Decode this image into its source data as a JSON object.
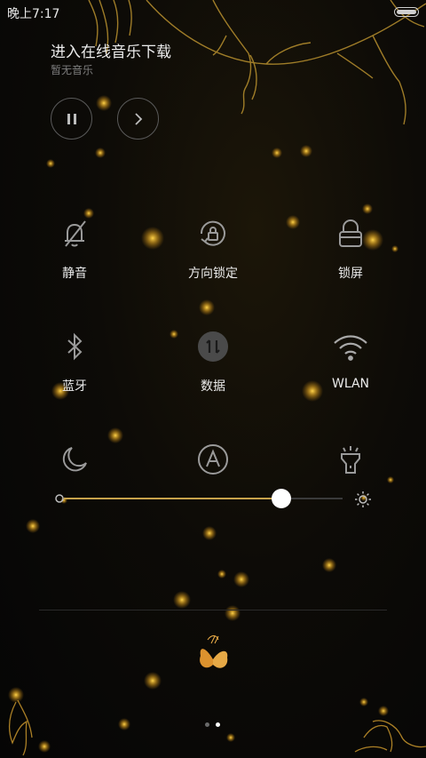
{
  "status_bar": {
    "time": "晚上7:17",
    "battery_icon": "battery-icon"
  },
  "music": {
    "title": "进入在线音乐下载",
    "subtitle": "暂无音乐",
    "pause_icon": "pause-icon",
    "next_icon": "next-icon"
  },
  "toggles": [
    {
      "label": "静音",
      "icon": "bell-off-icon"
    },
    {
      "label": "方向锁定",
      "icon": "rotation-lock-icon"
    },
    {
      "label": "锁屏",
      "icon": "lock-icon"
    },
    {
      "label": "蓝牙",
      "icon": "bluetooth-icon"
    },
    {
      "label": "数据",
      "icon": "mobile-data-icon"
    },
    {
      "label": "WLAN",
      "icon": "wifi-icon"
    },
    {
      "label": "",
      "icon": "moon-icon"
    },
    {
      "label": "",
      "icon": "auto-brightness-icon"
    },
    {
      "label": "",
      "icon": "flashlight-icon"
    }
  ],
  "brightness": {
    "level": 0.78,
    "low_icon": "brightness-low-icon",
    "high_icon": "brightness-high-icon"
  },
  "pager": {
    "pages": 2,
    "current": 2,
    "active_color": "#ffffff",
    "inactive_color": "#6a6a6a"
  },
  "theme": {
    "accent": "#c7a24b",
    "text": "#ececec",
    "secondary_text": "#7d7d7d"
  }
}
